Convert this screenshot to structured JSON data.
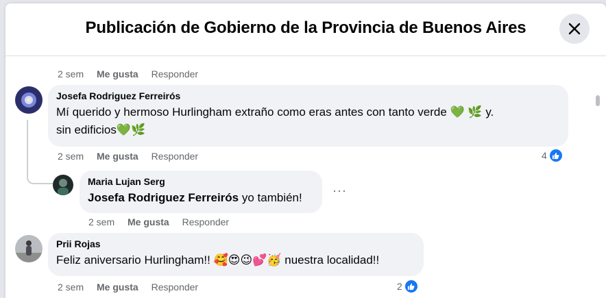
{
  "header": {
    "title": "Publicación de Gobierno de la Provincia de Buenos Aires"
  },
  "previous_comment": {
    "time": "2 sem",
    "like_label": "Me gusta",
    "reply_label": "Responder"
  },
  "comments": [
    {
      "author": "Josefa Rodriguez Ferreirós",
      "text_line1": "Mí querido y hermoso Hurlingham extraño como eras antes con tanto verde ",
      "emoji1": "💚",
      "emoji2": "🌿",
      "text_line1_end": " y.",
      "text_line2": "sin edificios",
      "emoji3": "💚🌿",
      "time": "2 sem",
      "like_label": "Me gusta",
      "reply_label": "Responder",
      "reaction_count": "4"
    },
    {
      "author": "Maria Lujan Serg",
      "mention": "Josefa Rodriguez Ferreirós",
      "text": " yo también!",
      "time": "2 sem",
      "like_label": "Me gusta",
      "reply_label": "Responder",
      "more_label": "···"
    },
    {
      "author": "Prii Rojas",
      "text": "Feliz aniversario Hurlingham!! ",
      "emojis": "🥰😍😉💕🥳",
      "text_end": " nuestra localidad!!",
      "time": "2 sem",
      "like_label": "Me gusta",
      "reply_label": "Responder",
      "reaction_count": "2"
    }
  ],
  "colors": {
    "accent": "#1877f2",
    "bubble": "#f0f2f5",
    "secondary_text": "#65676b"
  }
}
